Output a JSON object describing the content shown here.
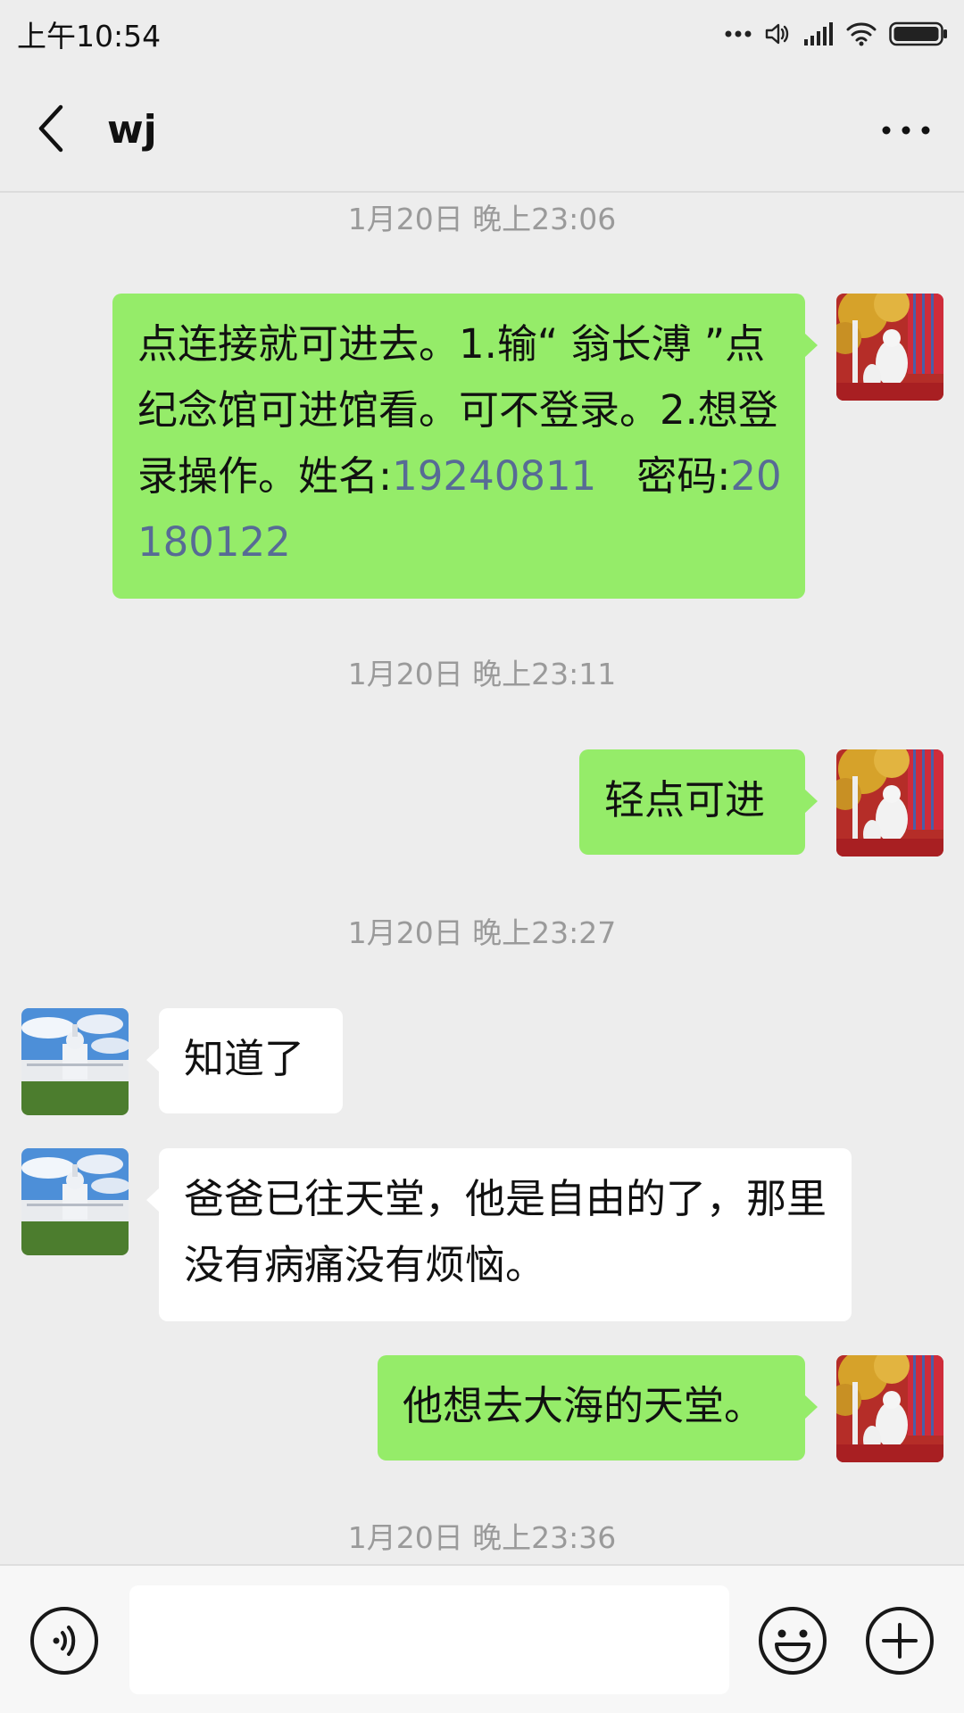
{
  "status_bar": {
    "time": "上午10:54",
    "icons": [
      "more-dots-icon",
      "volume-icon",
      "signal-icon",
      "wifi-icon",
      "battery-icon"
    ]
  },
  "header": {
    "title": "wj",
    "back_icon": "chevron-left-icon",
    "more_icon": "more-horizontal-icon"
  },
  "colors": {
    "outgoing_bubble": "#95ec69",
    "incoming_bubble": "#ffffff",
    "background": "#ededed",
    "link_number": "#576b95"
  },
  "messages": [
    {
      "type": "timestamp",
      "text": "1月20日 晚上23:06"
    },
    {
      "type": "outgoing",
      "parts": [
        "点连接就可进去。1.输“ 翁长溥 ”点纪念馆可进馆看。可不登录。2.想登录操作。姓名:",
        "19240811",
        "　密码:",
        "20180122"
      ]
    },
    {
      "type": "timestamp",
      "text": "1月20日 晚上23:11"
    },
    {
      "type": "outgoing",
      "text": "轻点可进"
    },
    {
      "type": "timestamp",
      "text": "1月20日 晚上23:27"
    },
    {
      "type": "incoming",
      "text": "知道了"
    },
    {
      "type": "incoming",
      "text": "爸爸已往天堂，他是自由的了，那里没有病痛没有烦恼。"
    },
    {
      "type": "outgoing",
      "text": "他想去大海的天堂。"
    },
    {
      "type": "timestamp",
      "text": "1月20日 晚上23:36"
    }
  ],
  "input_bar": {
    "voice_icon": "voice-icon",
    "input_value": "",
    "emoji_icon": "emoji-icon",
    "plus_icon": "plus-icon"
  }
}
